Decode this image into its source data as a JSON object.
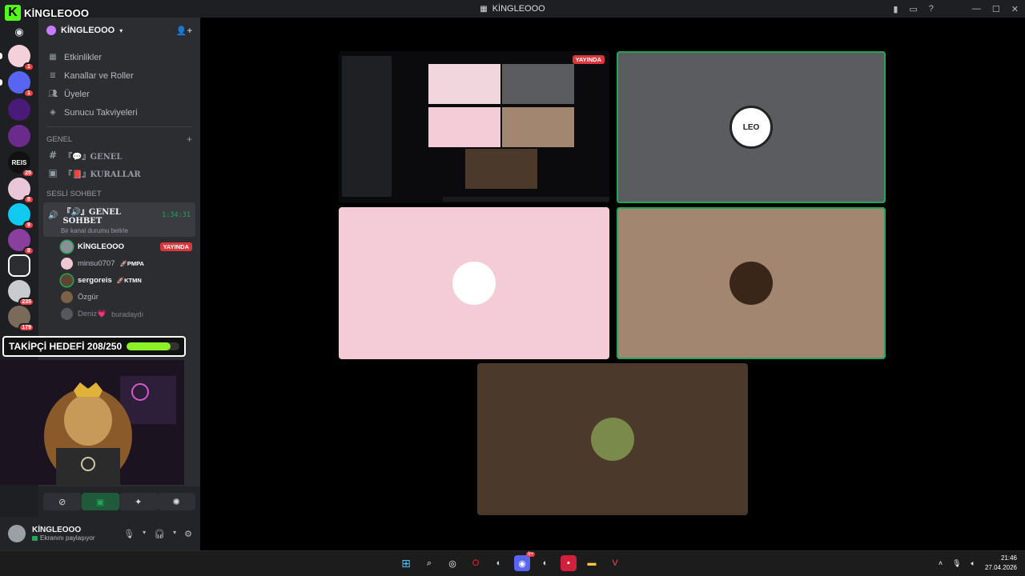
{
  "window": {
    "title": "KİNGLEOOO"
  },
  "overlay": {
    "brand": "KİNGLEOOO",
    "follow_goal": "TAKİPÇİ HEDEFİ 208/250",
    "follow_progress": 0.832
  },
  "guilds": [
    {
      "badge": "1"
    },
    {
      "badge": "1"
    },
    {
      "badge": ""
    },
    {
      "badge": ""
    },
    {
      "badge": "25",
      "label": "REIS"
    },
    {
      "badge": "8"
    },
    {
      "badge": "9"
    },
    {
      "badge": "8"
    },
    {
      "badge": ""
    },
    {
      "badge": "235"
    },
    {
      "badge": "179"
    }
  ],
  "server": {
    "name": "KİNGLEOOO",
    "menu": [
      {
        "label": "Etkinlikler"
      },
      {
        "label": "Kanallar ve Roller"
      },
      {
        "label": "Üyeler"
      },
      {
        "label": "Sunucu Takviyeleri"
      }
    ]
  },
  "text_category": "GENEL",
  "text_channels": [
    {
      "label": "『💬』GENEL"
    },
    {
      "label": "『📕』KURALLAR"
    }
  ],
  "voice_category": "SESLİ SOHBET",
  "voice_channel": {
    "name": "『🔊』GENEL SOHBET",
    "time": "1:34:31",
    "status": "Bir kanal durumu belirle"
  },
  "voice_users": [
    {
      "name": "KİNGLEOOO",
      "live": "YAYINDA",
      "tag": "",
      "color": "#ffffff"
    },
    {
      "name": "minsu0707",
      "live": "",
      "tag": "🚀PMPA",
      "color": "#b5bac1"
    },
    {
      "name": "sergoreis",
      "live": "",
      "tag": "🚀KTMN",
      "color": "#f2f3f5"
    },
    {
      "name": "Özgür",
      "live": "",
      "tag": "",
      "color": "#b5bac1"
    },
    {
      "name": "Deniz💗",
      "live": "",
      "tag": "buradaydı",
      "color": "#80848e"
    }
  ],
  "user_panel": {
    "name": "KİNGLEOOO",
    "status": "Ekranını paylaşıyor"
  },
  "stage": {
    "live_label": "YAYINDA",
    "tiles": [
      {
        "kind": "screen"
      },
      {
        "kind": "avatar",
        "avatar_text": "LEO",
        "bg": "#5a5c60"
      },
      {
        "kind": "avatar",
        "avatar_text": "",
        "bg": "#f4ccd8"
      },
      {
        "kind": "avatar",
        "avatar_text": "",
        "bg": "#a38670"
      },
      {
        "kind": "avatar",
        "avatar_text": "",
        "bg": "#4b3a2b"
      }
    ]
  },
  "taskbar": {
    "time": "21:46",
    "date": "27.04.2026",
    "discord_badge": "9+"
  }
}
